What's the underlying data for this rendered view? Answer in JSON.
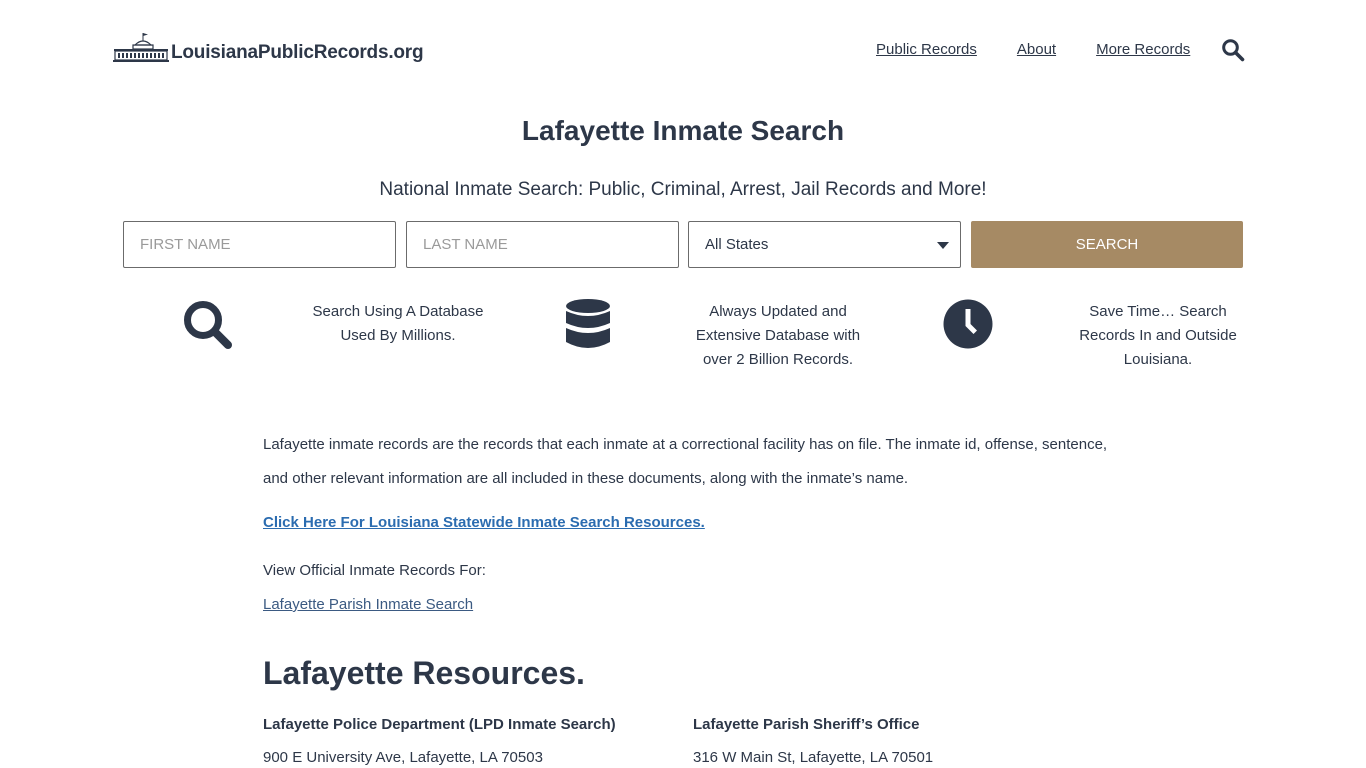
{
  "site": {
    "logo_text": "LouisianaPublicRecords.org"
  },
  "nav": {
    "items": [
      "Public Records",
      "About",
      "More Records"
    ]
  },
  "page": {
    "title": "Lafayette Inmate Search",
    "subtitle": "National Inmate Search: Public, Criminal, Arrest, Jail Records and More!"
  },
  "form": {
    "first_placeholder": "FIRST NAME",
    "last_placeholder": "LAST NAME",
    "state_selected": "All States",
    "search_label": "SEARCH"
  },
  "features": [
    {
      "icon": "search-icon",
      "text": "Search Using A Database Used By Millions."
    },
    {
      "icon": "database-icon",
      "text": "Always Updated and Extensive Database with over 2 Billion Records."
    },
    {
      "icon": "clock-icon",
      "text": "Save Time… Search Records In and Outside Louisiana."
    }
  ],
  "content": {
    "intro": "Lafayette inmate records are the records that each inmate at a correctional facility has on file. The inmate id, offense, sentence, and other relevant information are all included in these documents, along with the inmate’s name.",
    "statewide_link": "Click Here For Louisiana Statewide Inmate Search Resources.",
    "view_label": "View Official Inmate Records For:",
    "parish_link": "Lafayette Parish Inmate Search",
    "resources_title": "Lafayette Resources."
  },
  "resources": [
    {
      "name": "Lafayette Police Department (LPD Inmate Search)",
      "address": "900 E University Ave, Lafayette, LA 70503"
    },
    {
      "name": "Lafayette Parish Sheriff’s Office",
      "address": "316 W Main St, Lafayette, LA 70501"
    }
  ],
  "colors": {
    "text": "#2d3748",
    "button": "#a68a64",
    "link": "#2b6cb0"
  }
}
